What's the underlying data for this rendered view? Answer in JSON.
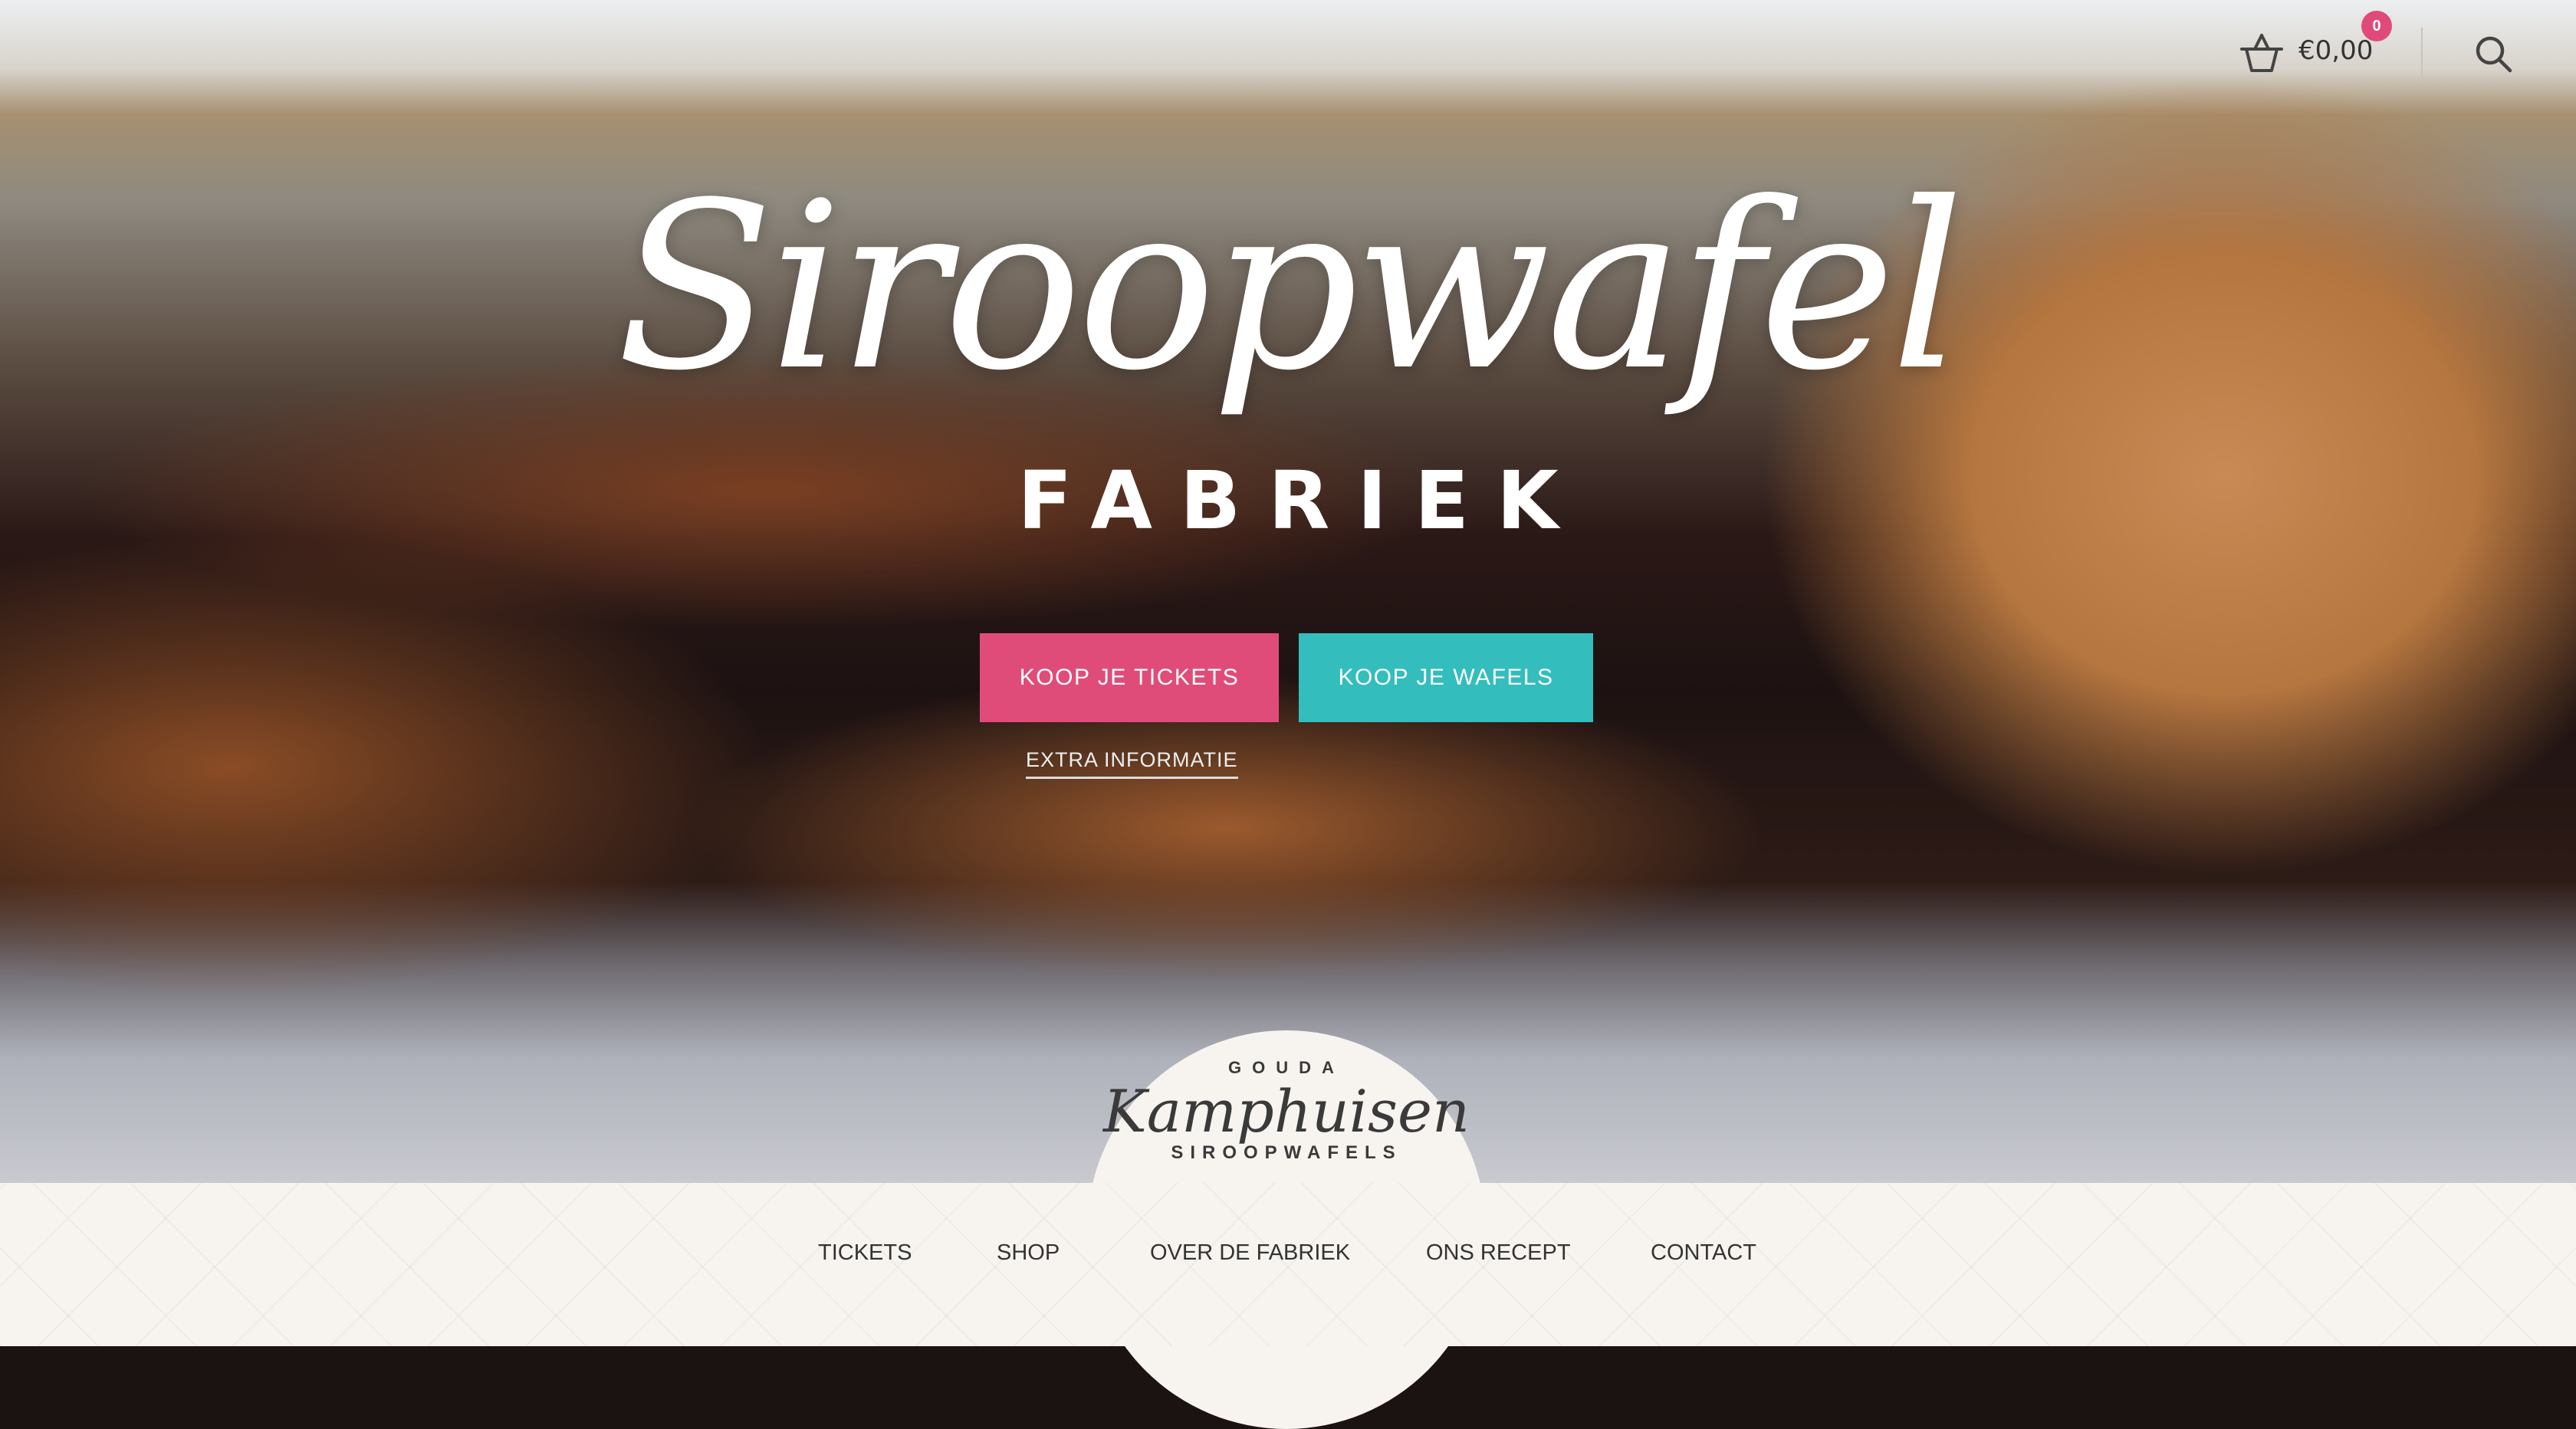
{
  "header": {
    "cart_icon": "basket-icon",
    "cart_total": "€0,00",
    "cart_count": "0",
    "search_icon": "search-icon"
  },
  "hero": {
    "title": "Siroopwafel",
    "subtitle": "FABRIEK",
    "buttons": [
      {
        "label": "KOOP JE TICKETS",
        "color": "#e04c7a"
      },
      {
        "label": "KOOP JE WAFELS",
        "color": "#33bdbd"
      }
    ],
    "extra_link": "EXTRA INFORMATIE"
  },
  "logo": {
    "top": "GOUDA",
    "name": "Kamphuisen",
    "bottom": "SIROOPWAFELS"
  },
  "nav": {
    "items": [
      {
        "label": "TICKETS"
      },
      {
        "label": "SHOP"
      },
      {
        "label": "OVER DE FABRIEK"
      },
      {
        "label": "ONS RECEPT"
      },
      {
        "label": "CONTACT"
      }
    ]
  }
}
